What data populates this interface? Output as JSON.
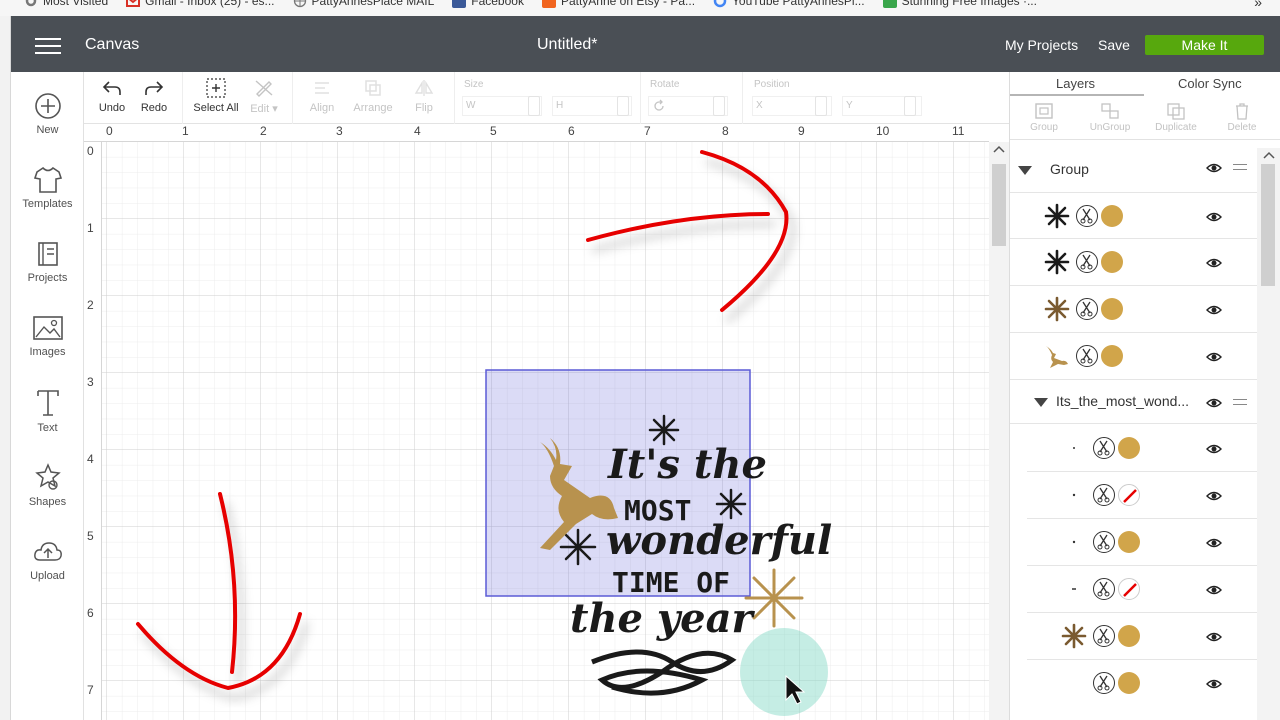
{
  "bookmarks": [
    {
      "label": "Most Visited",
      "icon": "gear-icon",
      "color": "#777777"
    },
    {
      "label": "Gmail - Inbox (25) - es...",
      "icon": "gmail-icon",
      "color": "#d93025"
    },
    {
      "label": "PattyAnnesPlace MAIL",
      "icon": "globe-icon",
      "color": "#777777"
    },
    {
      "label": "Facebook",
      "icon": "facebook-icon",
      "color": "#3b5998"
    },
    {
      "label": "PattyAnne on Etsy - Pa...",
      "icon": "etsy-icon",
      "color": "#f1641e"
    },
    {
      "label": "YouTube PattyAnnesPl...",
      "icon": "google-icon",
      "color": "#4285f4"
    },
    {
      "label": "Stunning Free Images ·...",
      "icon": "pa-icon",
      "color": "#3aa64b"
    }
  ],
  "bookmarks_more": "»",
  "header": {
    "app_title": "Canvas",
    "doc_title": "Untitled*",
    "my_projects": "My Projects",
    "save": "Save",
    "make": "Make It",
    "make_color": "#57a80d"
  },
  "sidebar": {
    "items": [
      {
        "label": "New",
        "icon": "plus-circle-icon"
      },
      {
        "label": "Templates",
        "icon": "shirt-icon"
      },
      {
        "label": "Projects",
        "icon": "projects-icon"
      },
      {
        "label": "Images",
        "icon": "image-icon"
      },
      {
        "label": "Text",
        "icon": "text-icon"
      },
      {
        "label": "Shapes",
        "icon": "shapes-icon"
      },
      {
        "label": "Upload",
        "icon": "cloud-upload-icon"
      }
    ]
  },
  "toolbar": {
    "undo": "Undo",
    "redo": "Redo",
    "select_all": "Select All",
    "edit": "Edit",
    "align": "Align",
    "arrange": "Arrange",
    "flip": "Flip",
    "size_label": "Size",
    "size_w": "W",
    "size_h": "H",
    "rotate_label": "Rotate",
    "position_label": "Position",
    "pos_x": "X",
    "pos_y": "Y"
  },
  "rulers": {
    "horizontal": [
      "0",
      "1",
      "2",
      "3",
      "4",
      "5",
      "6",
      "7",
      "8",
      "9",
      "10",
      "11"
    ],
    "vertical": [
      "0",
      "1",
      "2",
      "3",
      "4",
      "5",
      "6",
      "7"
    ]
  },
  "canvas_art": {
    "line1": "It's the",
    "line2": "MOST",
    "line3": "wonderful",
    "line4": "TIME OF",
    "line5": "the year",
    "gold": "#b8924e",
    "dark": "#1a1a1a",
    "selection_color": "#5b5bd6",
    "annotation_color": "#e60000"
  },
  "layers_panel": {
    "tabs": [
      "Layers",
      "Color Sync"
    ],
    "actions": [
      "Group",
      "UnGroup",
      "Duplicate",
      "Delete"
    ],
    "group_label": "Group",
    "subgroup_label": "Its_the_most_wond...",
    "rows": [
      {
        "thumb": "snowflake-icon",
        "color": "gold",
        "thumb_color": "#1a1a1a"
      },
      {
        "thumb": "snowflake-icon",
        "color": "gold",
        "thumb_color": "#1a1a1a"
      },
      {
        "thumb": "snowflake-icon",
        "color": "gold",
        "thumb_color": "#7a5a30"
      },
      {
        "thumb": "deer-icon",
        "color": "gold",
        "thumb_color": "#b8924e"
      },
      {
        "thumb": "dot-icon",
        "color": "gold",
        "thumb_color": "#333333"
      },
      {
        "thumb": "dot-icon",
        "color": "none",
        "thumb_color": "#333333"
      },
      {
        "thumb": "dot-icon",
        "color": "gold",
        "thumb_color": "#333333"
      },
      {
        "thumb": "dot-icon",
        "color": "none",
        "thumb_color": "#333333"
      },
      {
        "thumb": "snowflake-icon",
        "color": "gold",
        "thumb_color": "#7a5a30"
      },
      {
        "thumb": "blank",
        "color": "gold",
        "thumb_color": "#333333"
      }
    ],
    "gold_color": "#d1a54a"
  }
}
